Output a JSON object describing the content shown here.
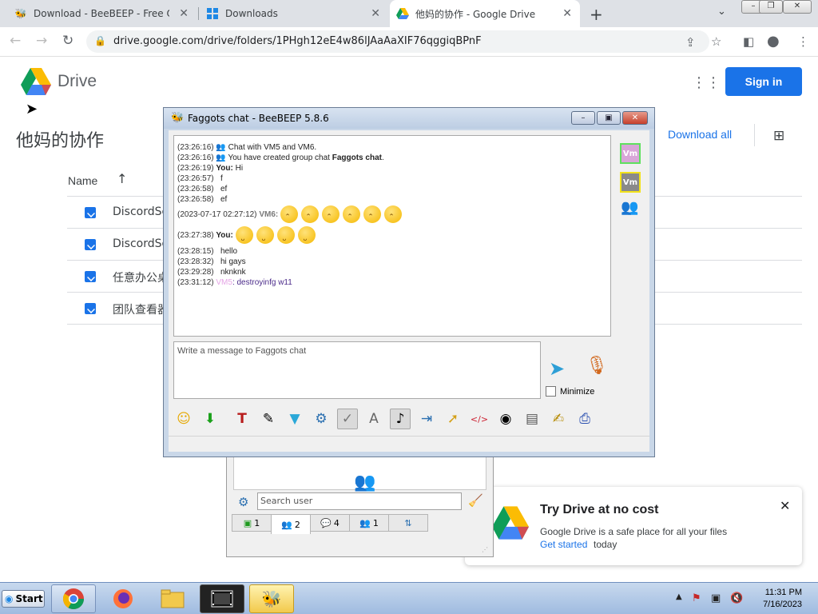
{
  "browser": {
    "tabs": [
      {
        "title": "Download - BeeBEEP - Free Offic",
        "icon": "bee-icon",
        "active": false
      },
      {
        "title": "Downloads",
        "icon": "windows-icon",
        "active": false
      },
      {
        "title": "他妈的协作 - Google Drive",
        "icon": "drive-icon",
        "active": true
      }
    ],
    "tab_close_glyph": "✕",
    "new_tab_glyph": "+",
    "tab_menu_glyph": "⌄",
    "url": "drive.google.com/drive/folders/1PHgh12eE4w86lJAaAaXIF76qggiqBPnF"
  },
  "drive": {
    "brand": "Drive",
    "signin_label": "Sign in",
    "folder_title": "他妈的协作",
    "download_all": "Download all",
    "column_name": "Name",
    "sort_arrow": "↑",
    "files": [
      "DiscordSe",
      "DiscordSe",
      "任意办公桌",
      "团队查看器"
    ],
    "promo": {
      "title": "Try Drive at no cost",
      "text": "Google Drive is a safe place for all your files",
      "link": "Get started",
      "tail": "today",
      "close": "✕"
    },
    "colors": {
      "accent": "#1a73e8"
    }
  },
  "chat": {
    "window_title": "Faggots chat - BeeBEEP 5.8.6",
    "messages": [
      {
        "time": "(23:26:16)",
        "icon": true,
        "text": "Chat with VM5 and VM6."
      },
      {
        "time": "(23:26:16)",
        "icon": true,
        "text": "You have created group chat ",
        "bold": "Faggots chat",
        "suffix": "."
      },
      {
        "time": "(23:26:19)",
        "who": "You:",
        "text": "Hi"
      },
      {
        "time": "(23:26:57)",
        "text": "f"
      },
      {
        "time": "(23:26:58)",
        "text": "ef"
      },
      {
        "time": "(23:26:58)",
        "text": "ef"
      },
      {
        "time": "(2023-07-17 02:27:12)",
        "who": "VM6:",
        "emoji": [
          "sad",
          "sad",
          "sad",
          "sad",
          "sad",
          "sad"
        ]
      },
      {
        "time": "(23:27:38)",
        "who": "You:",
        "emoji": [
          "sweat",
          "sweat",
          "sweat",
          "sweat"
        ]
      },
      {
        "time": "(23:28:15)",
        "text": "hello"
      },
      {
        "time": "(23:28:32)",
        "text": "hi gays"
      },
      {
        "time": "(23:29:28)",
        "text": "nknknk"
      },
      {
        "time": "(23:31:12)",
        "who": "VM5",
        "text": ": destroyinfg w11"
      }
    ],
    "input_placeholder": "Write a message to Faggots chat",
    "minimize_label": "Minimize",
    "avatars": [
      "Vm",
      "Vm"
    ],
    "tools": [
      "smiley-icon",
      "save-icon",
      "font-icon",
      "color-icon",
      "filter-icon",
      "settings-icon",
      "spellcheck-icon",
      "text-icon",
      "music-icon",
      "export-icon",
      "share-icon",
      "code-icon",
      "screenshot-icon",
      "image-icon",
      "edit-icon",
      "print-icon"
    ]
  },
  "userpanel": {
    "search_placeholder": "Search user",
    "tabs": [
      {
        "icon": "users-online-icon",
        "count": "1"
      },
      {
        "icon": "group-icon",
        "count": "2"
      },
      {
        "icon": "chat-icon",
        "count": "4"
      },
      {
        "icon": "people-icon",
        "count": "1"
      },
      {
        "icon": "share-icon",
        "count": ""
      }
    ]
  },
  "taskbar": {
    "start_label": "Start",
    "apps": [
      "chrome-icon",
      "firefox-icon",
      "explorer-icon",
      "media-icon",
      "beebeep-icon"
    ],
    "time": "11:31 PM",
    "date": "7/16/2023"
  }
}
